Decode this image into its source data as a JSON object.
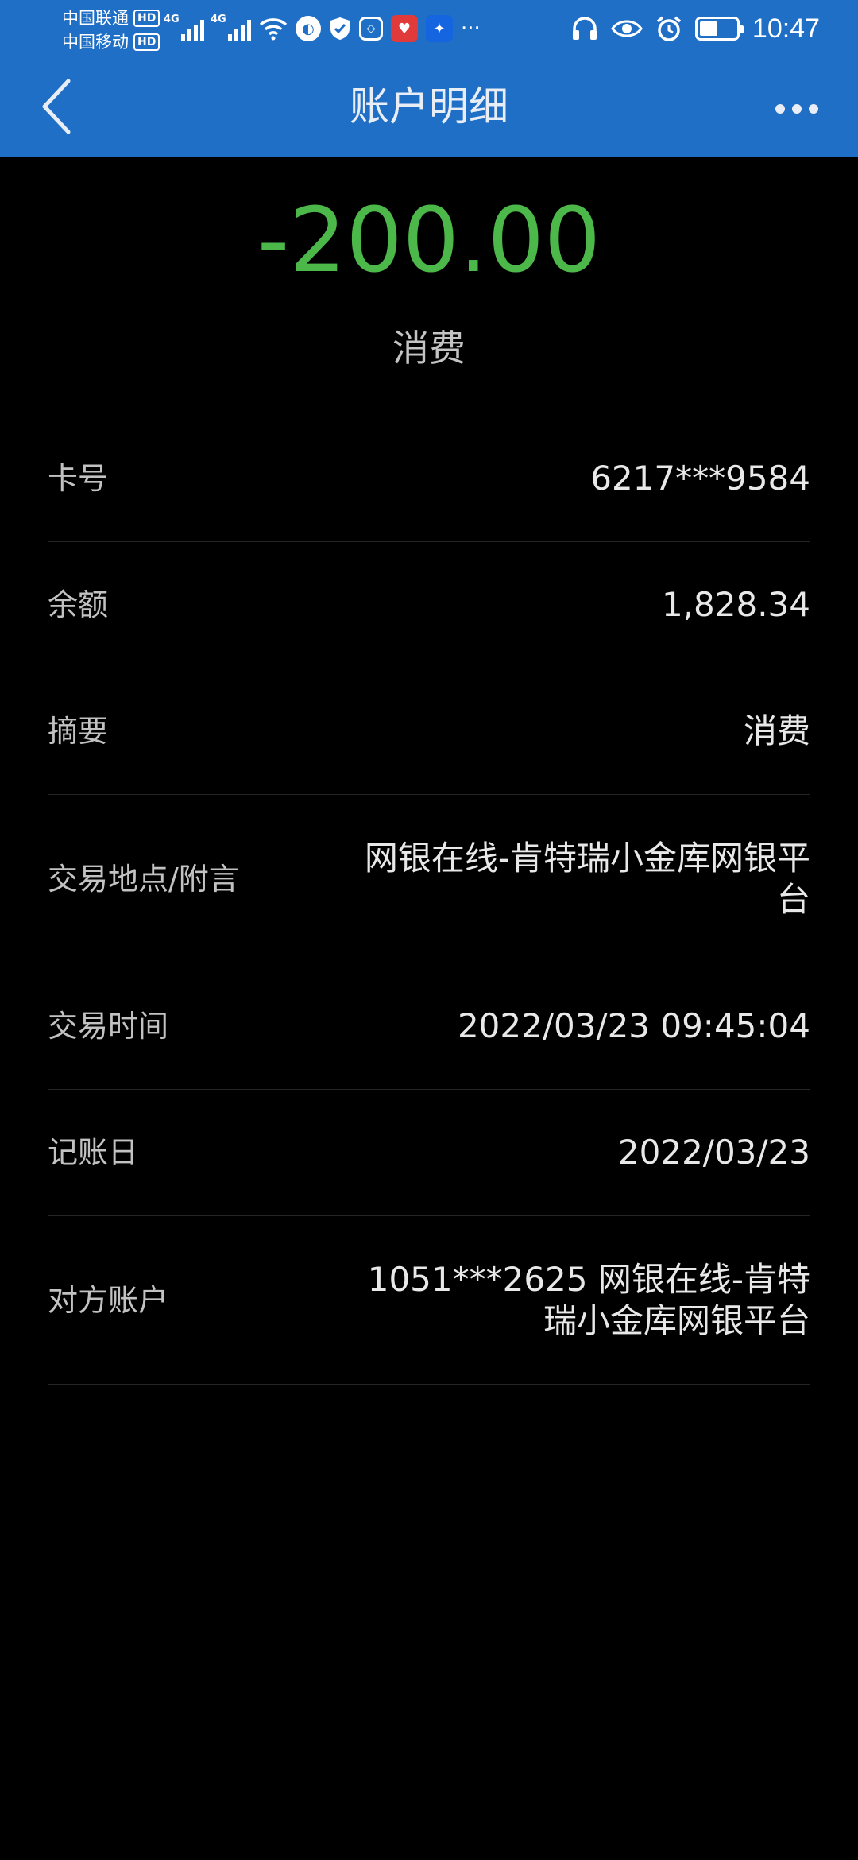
{
  "status_bar": {
    "carrier_1": "中国联通",
    "carrier_2": "中国移动",
    "hd_badge": "HD",
    "network_tag_1": "4G",
    "network_tag_2": "4G",
    "time": "10:47"
  },
  "header": {
    "title": "账户明细"
  },
  "transaction": {
    "amount": "-200.00",
    "type": "消费",
    "amount_color": "#4cb84a"
  },
  "details": [
    {
      "label": "卡号",
      "value": "6217***9584"
    },
    {
      "label": "余额",
      "value": "1,828.34"
    },
    {
      "label": "摘要",
      "value": "消费"
    },
    {
      "label": "交易地点/附言",
      "value": "网银在线-肯特瑞小金库网银平台"
    },
    {
      "label": "交易时间",
      "value": "2022/03/23 09:45:04"
    },
    {
      "label": "记账日",
      "value": "2022/03/23"
    },
    {
      "label": "对方账户",
      "value": "1051***2625 网银在线-肯特瑞小金库网银平台"
    }
  ],
  "colors": {
    "header_bg": "#1f6fc6",
    "page_bg": "#000000",
    "amount": "#4cb84a"
  }
}
